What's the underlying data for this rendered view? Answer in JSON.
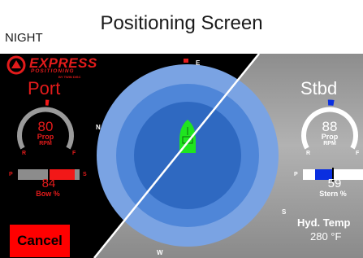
{
  "header": {
    "title": "Positioning Screen",
    "mode": "NIGHT"
  },
  "logo": {
    "brand": "EXPRESS",
    "subtitle": "POSITIONING",
    "maker": "BY TWIN DISC"
  },
  "port": {
    "title": "Port",
    "rpm": "80",
    "prop_label": "Prop",
    "rpm_label": "RPM",
    "reverse_label": "R",
    "forward_label": "F",
    "thruster_value": "84",
    "thruster_label": "Bow %",
    "port_side_label": "P",
    "starboard_side_label": "S",
    "thruster_level": 0.84,
    "thruster_direction": "S"
  },
  "stbd": {
    "title": "Stbd",
    "rpm": "88",
    "prop_label": "Prop",
    "rpm_label": "RPM",
    "reverse_label": "R",
    "forward_label": "F",
    "thruster_value": "59",
    "thruster_label": "Stern %",
    "port_side_label": "P",
    "starboard_side_label": "S",
    "thruster_level": 0.59,
    "thruster_direction": "P"
  },
  "compass": {
    "north": "N",
    "east": "E",
    "south": "S",
    "west": "W"
  },
  "cancel": {
    "label": "Cancel"
  },
  "hydraulics": {
    "label": "Hyd. Temp",
    "value": "280 °F"
  },
  "colors": {
    "night_background": "#000000",
    "night_accent": "#e31b1b",
    "day_text": "#ffffff",
    "compass_outer": "#7aa3e3",
    "compass_mid": "#4f86d8",
    "compass_inner": "#2f69c1",
    "boat": "#1fe51f",
    "stbd_accent": "#0a2fe0",
    "cancel_button": "#ff0000"
  },
  "icons": {
    "logo": "express-logo-icon",
    "boat": "boat-icon",
    "heading_marker": "heading-marker-icon"
  }
}
